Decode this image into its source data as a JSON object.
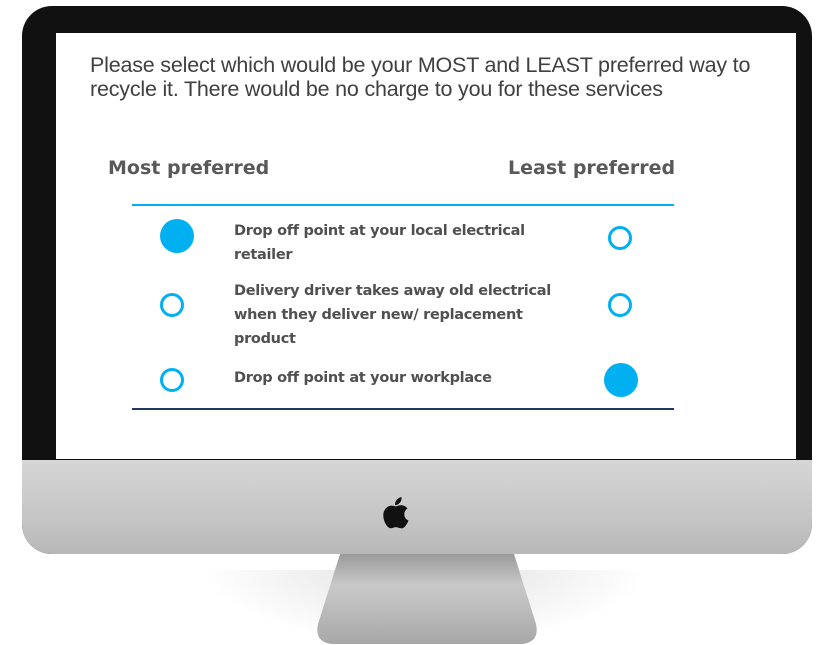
{
  "question": "Please select which would be your MOST and LEAST preferred way to recycle it. There would be no charge to you for these services",
  "columns": {
    "most": "Most preferred",
    "least": "Least preferred"
  },
  "options": [
    {
      "label": "Drop off point at your local electrical retailer",
      "most_selected": true,
      "least_selected": false
    },
    {
      "label": "Delivery driver takes away old electrical when they deliver new/ replacement product",
      "most_selected": false,
      "least_selected": false
    },
    {
      "label": "Drop off point at your workplace",
      "most_selected": false,
      "least_selected": true
    }
  ],
  "colors": {
    "accent": "#00b0f0",
    "text": "#404040",
    "bottom_rule": "#1f3864"
  },
  "icons": {
    "logo": "apple-logo-icon"
  }
}
